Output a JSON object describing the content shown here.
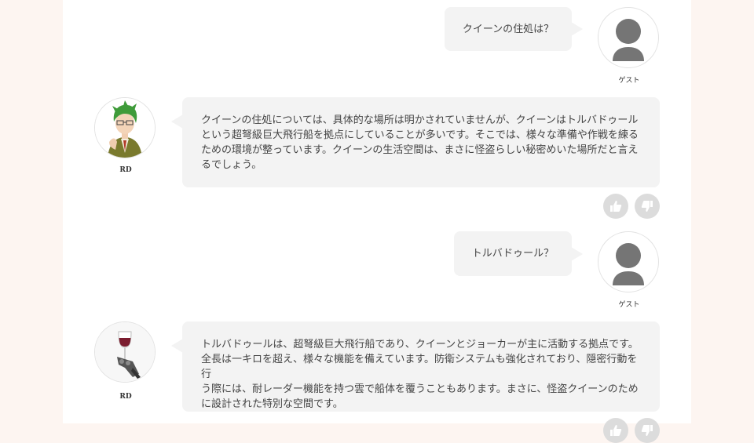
{
  "messages": [
    {
      "role": "user",
      "sender_name": "ゲスト",
      "text": "クイーンの住処は？",
      "avatar_icon": "person-silhouette-icon"
    },
    {
      "role": "bot",
      "sender_name": "RD",
      "lines": [
        "クイーンの住処については、具体的な場所は明かされていませんが、クイーンはトルバドゥール",
        "という超弩級巨大飛行船を拠点にしていることが多いです。そこでは、様々な準備や作戦を練る",
        "ための環境が整っています。クイーンの生活空間は、まさに怪盗らしい秘密めいた場所だと言え",
        "るでしょう。"
      ],
      "avatar_icon": "green-haired-character-icon"
    },
    {
      "role": "user",
      "sender_name": "ゲスト",
      "text": "トルバドゥール？",
      "avatar_icon": "person-silhouette-icon"
    },
    {
      "role": "bot",
      "sender_name": "RD",
      "lines": [
        "トルバドゥールは、超弩級巨大飛行船であり、クイーンとジョーカーが主に活動する拠点です。",
        "全長は一キロを超え、様々な機能を備えています。防衛システムも強化されており、隠密行動を行",
        "う際には、耐レーダー機能を持つ雲で船体を覆うこともあります。まさに、怪盗クイーンのため",
        "に設計された特別な空間です。"
      ],
      "avatar_icon": "robot-hand-wine-glass-icon"
    }
  ],
  "feedback": {
    "like_icon": "thumbs-up-icon",
    "dislike_icon": "thumbs-down-icon"
  },
  "colors": {
    "page_bg": "#fdf5f1",
    "panel_bg": "#ffffff",
    "bubble_bg": "#f3f3f3",
    "button_bg": "#dcdcdc",
    "silhouette": "#757575"
  }
}
